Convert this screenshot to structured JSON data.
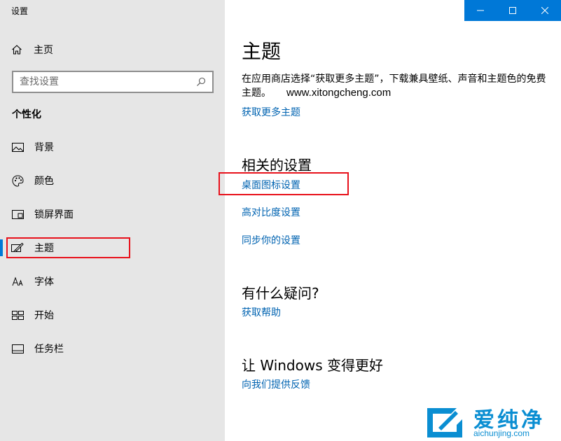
{
  "window": {
    "title": "设置",
    "accent_color": "#0078d7",
    "controls": [
      "minimize-icon",
      "maximize-icon",
      "close-icon"
    ]
  },
  "sidebar": {
    "home_label": "主页",
    "search_placeholder": "查找设置",
    "section": "个性化",
    "items": [
      {
        "label": "背景",
        "icon": "picture-icon"
      },
      {
        "label": "颜色",
        "icon": "palette-icon"
      },
      {
        "label": "锁屏界面",
        "icon": "lock-screen-icon"
      },
      {
        "label": "主题",
        "icon": "theme-brush-icon",
        "active": true
      },
      {
        "label": "字体",
        "icon": "font-icon"
      },
      {
        "label": "开始",
        "icon": "start-tiles-icon"
      },
      {
        "label": "任务栏",
        "icon": "taskbar-icon"
      }
    ]
  },
  "main": {
    "title": "主题",
    "description": "在应用商店选择“获取更多主题”，下载兼具壁纸、声音和主题色的免费主题。",
    "description_url": "www.xitongcheng.com",
    "get_more_link": "获取更多主题",
    "related_heading": "相关的设置",
    "related_links": [
      "桌面图标设置",
      "高对比度设置",
      "同步你的设置"
    ],
    "question_heading": "有什么疑问?",
    "help_link": "获取帮助",
    "feedback_heading": "让 Windows 变得更好",
    "feedback_link": "向我们提供反馈",
    "link_color": "#0063b1"
  },
  "annotation_color": "#e8111b",
  "watermark": {
    "brand": "爱纯净",
    "domain": "aichunjing.com"
  }
}
